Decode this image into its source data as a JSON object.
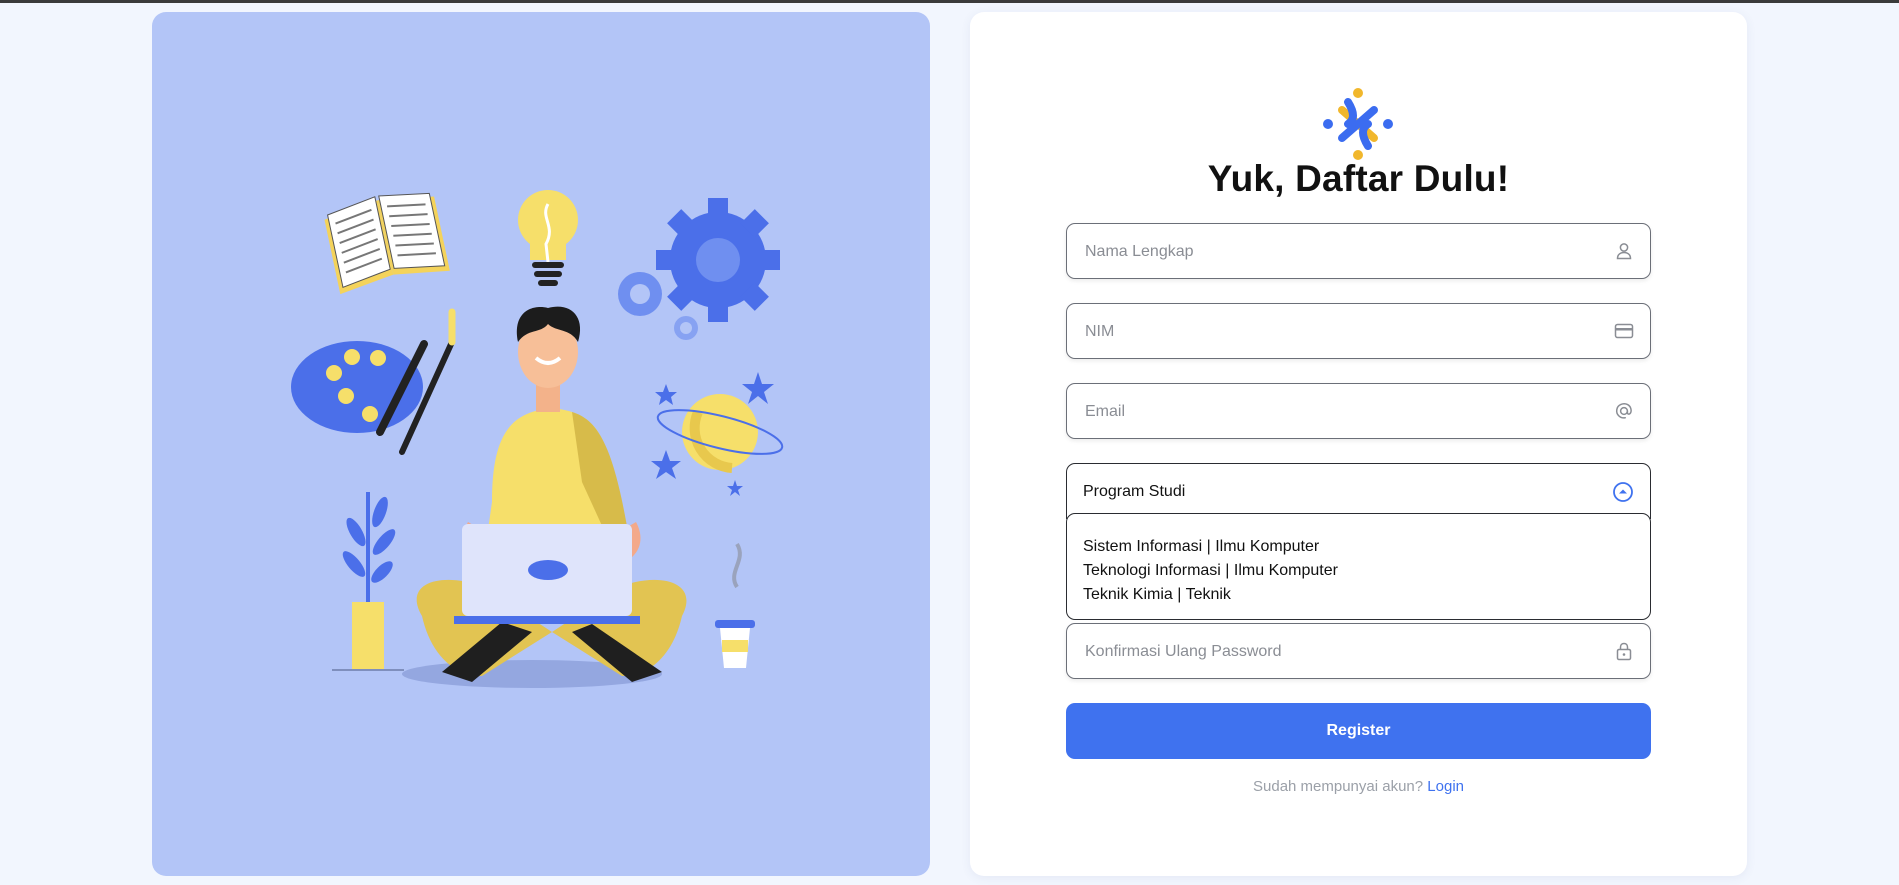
{
  "page": {
    "title": "Yuk, Daftar Dulu!"
  },
  "colors": {
    "background": "#f2f6fe",
    "illustration_panel": "#b3c5f7",
    "accent": "#3f72ef",
    "logo_blue": "#3b6cf0",
    "logo_yellow": "#f1b72c"
  },
  "illustration": {
    "icons": [
      "book-icon",
      "lightbulb-icon",
      "gear-icon",
      "palette-icon",
      "planet-icon",
      "plant-icon",
      "coffee-cup-icon",
      "person-with-laptop"
    ]
  },
  "form": {
    "fields": [
      {
        "placeholder": "Nama Lengkap",
        "value": "",
        "icon": "user-icon"
      },
      {
        "placeholder": "NIM",
        "value": "",
        "icon": "id-card-icon"
      },
      {
        "placeholder": "Email",
        "value": "",
        "icon": "at-sign-icon"
      }
    ],
    "program_select": {
      "value": "Program Studi",
      "icon": "chevron-up-circle-icon",
      "options": [
        "Sistem Informasi | Ilmu Komputer",
        "Teknologi Informasi | Ilmu Komputer",
        "Teknik Kimia | Teknik"
      ]
    },
    "confirm_password": {
      "placeholder": "Konfirmasi Ulang Password",
      "value": "",
      "icon": "lock-icon"
    },
    "submit_label": "Register",
    "footer": {
      "text": "Sudah mempunyai akun?",
      "link_label": "Login"
    }
  }
}
